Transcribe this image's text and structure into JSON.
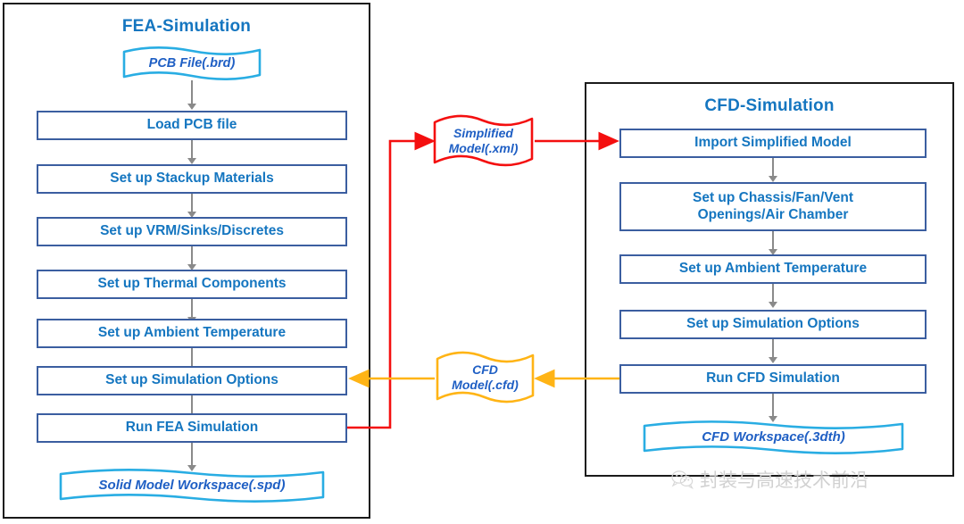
{
  "diagram": {
    "title_fea": "FEA-Simulation",
    "title_cfd": "CFD-Simulation",
    "colors": {
      "process_border": "#3b5ea0",
      "process_text": "#1576c0",
      "panel_border": "#1a1a1a",
      "doc_cyan": "#29ade3",
      "doc_red": "#f40f0f",
      "doc_yellow": "#ffb415",
      "arrow_grey": "#8a8a8a",
      "doc_text": "#1f5fc4"
    }
  },
  "fea": {
    "title": "FEA-Simulation",
    "input_doc": "PCB File(.brd)",
    "steps": [
      "Load PCB file",
      "Set up Stackup Materials",
      "Set up VRM/Sinks/Discretes",
      "Set up Thermal Components",
      "Set up Ambient Temperature",
      "Set up Simulation Options",
      "Run FEA Simulation"
    ],
    "output_doc": "Solid Model Workspace(.spd)"
  },
  "cfd": {
    "title": "CFD-Simulation",
    "steps": [
      "Import Simplified Model",
      "Set up Chassis/Fan/Vent\nOpenings/Air Chamber",
      "Set up Ambient Temperature",
      "Set up Simulation Options",
      "Run CFD Simulation"
    ],
    "output_doc": "CFD Workspace(.3dth)"
  },
  "connectors": {
    "simplified_model": {
      "label_line1": "Simplified",
      "label_line2": "Model(.xml)",
      "color": "#f40f0f",
      "from": "Run FEA Simulation",
      "to": "Import Simplified Model"
    },
    "cfd_model": {
      "label_line1": "CFD",
      "label_line2": "Model(.cfd)",
      "color": "#ffb415",
      "from": "Run CFD Simulation",
      "to": "Set up Simulation Options"
    }
  },
  "watermark": {
    "icon": "wechat-icon",
    "text": "封装与高速技术前沿"
  }
}
